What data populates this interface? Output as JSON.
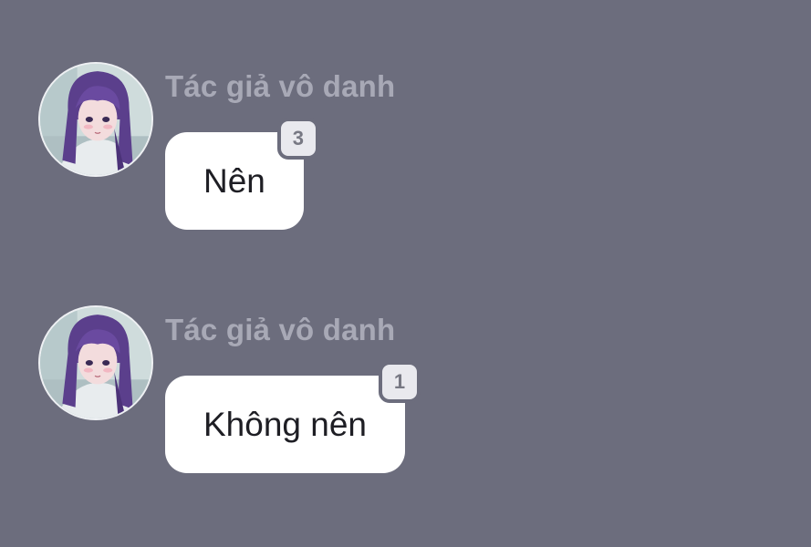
{
  "messages": [
    {
      "sender": "Tác giả vô danh",
      "text": "Nên",
      "reaction_count": "3",
      "avatar_icon": "anime-girl-avatar"
    },
    {
      "sender": "Tác giả vô danh",
      "text": "Không nên",
      "reaction_count": "1",
      "avatar_icon": "anime-girl-avatar"
    }
  ],
  "colors": {
    "background": "#6c6d7d",
    "bubble": "#ffffff",
    "sender_text": "#a8a9b6",
    "badge": "#e9e9ee"
  }
}
